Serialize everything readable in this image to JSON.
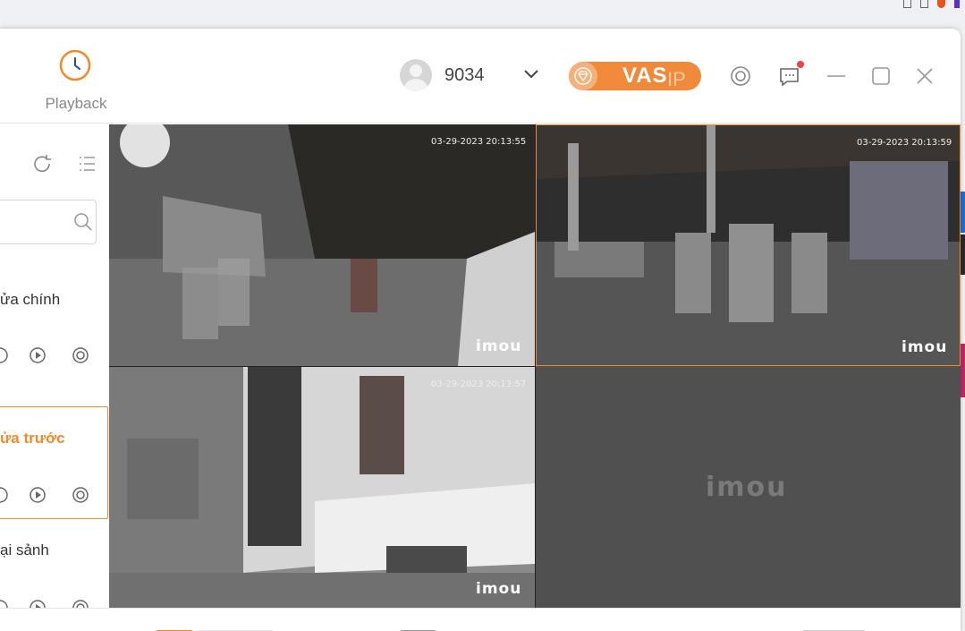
{
  "header": {
    "tab_label": "Playback",
    "user_id": "9034",
    "vas_label": "VAS",
    "vas_suffix": "IP"
  },
  "sidebar": {
    "devices": [
      {
        "name": "ửa chính",
        "active": false
      },
      {
        "name": "ửa trước",
        "active": true
      },
      {
        "name": "ại sảnh",
        "active": false
      }
    ]
  },
  "cameras": [
    {
      "timestamp": "03-29-2023 20:13:55",
      "watermark": "imou"
    },
    {
      "timestamp": "03-29-2023 20:13:59",
      "watermark": "imou"
    },
    {
      "timestamp": "03-29-2023 20:13:57",
      "watermark": "imou"
    }
  ],
  "empty_cell_logo": "imou",
  "colors": {
    "accent": "#f08a2a",
    "vas_badge": "#f08a3a",
    "empty_cell": "#505050"
  }
}
